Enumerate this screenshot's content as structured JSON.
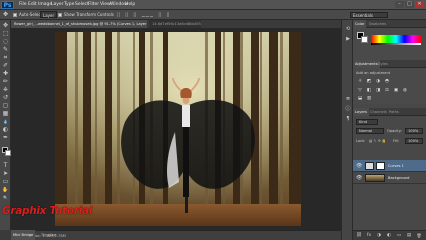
{
  "app": {
    "logo": "Ps",
    "menu": [
      "File",
      "Edit",
      "Image",
      "Layer",
      "Type",
      "Select",
      "Filter",
      "View",
      "Window",
      "Help"
    ],
    "window_controls": {
      "minimize": "–",
      "maximize": "□",
      "close": "✕"
    }
  },
  "options_bar": {
    "auto_select_label": "Auto-Select:",
    "auto_select_value": "Layer",
    "show_transform_label": "Show Transform Controls",
    "workspace": "Essentials"
  },
  "tabs": [
    {
      "label": "flower_girl_...weddbonnel_1_of_shubmoseb.jpg @ 91.7% (Curves 1, Layer Mask/8)",
      "active": true
    },
    {
      "label": "14.6d7ef56c13a6cd8bb0f3b88.jpg @ 66.7% (RGB/8)",
      "active": false
    }
  ],
  "toolbar": {
    "tools": [
      "move-icon",
      "marquee-icon",
      "lasso-icon",
      "quick-select-icon",
      "crop-icon",
      "eyedropper-icon",
      "healing-icon",
      "brush-icon",
      "stamp-icon",
      "history-brush-icon",
      "eraser-icon",
      "gradient-icon",
      "blur-icon",
      "dodge-icon",
      "pen-icon",
      "type-icon",
      "path-select-icon",
      "shape-icon",
      "hand-icon",
      "zoom-icon"
    ],
    "glyphs": [
      "✥",
      "⬚",
      "◌",
      "✎",
      "⌗",
      "✐",
      "✚",
      "✏",
      "⎈",
      "↺",
      "◻",
      "▦",
      "💧",
      "◐",
      "✒",
      "T",
      "➤",
      "▭",
      "✋",
      "🔍"
    ]
  },
  "status_bar": {
    "zoom": "91.67%",
    "doc_info": "Doc: 1.48M/2.78M",
    "minibridge_tab": "Mini Bridge",
    "timeline_tab": "Timeline"
  },
  "watermark": "Graphix Tutorial",
  "right_icons": [
    "history-icon",
    "actions-icon",
    "properties-icon",
    "info-icon",
    "paragraph-icon"
  ],
  "right_icon_glyphs": [
    "⟲",
    "▶",
    "≣",
    "ⓘ",
    "¶"
  ],
  "panels": {
    "color_tabs": [
      "Color",
      "Swatches"
    ],
    "adjust_tabs": [
      "Adjustments",
      "Styles"
    ],
    "adjust_title": "Add an adjustment",
    "adjust_icons": [
      "☼",
      "◩",
      "◑",
      "◓",
      "▽",
      "◧",
      "◨",
      "⚖",
      "▣",
      "◍",
      "⬓",
      "▥"
    ],
    "layers_tabs": [
      "Layers",
      "Channels",
      "Paths"
    ],
    "kind_label": "Kind",
    "blend_mode": "Normal",
    "opacity_label": "Opacity:",
    "opacity_value": "100%",
    "lock_label": "Lock:",
    "fill_label": "Fill:",
    "fill_value": "100%",
    "layers": [
      {
        "name": "Curves 1",
        "visible": true,
        "selected": true
      },
      {
        "name": "Background",
        "visible": true,
        "selected": false
      }
    ],
    "footer_icons": [
      "⛓",
      "fx",
      "◑",
      "◐",
      "▭",
      "▤",
      "🗑"
    ]
  },
  "colors": {
    "accent_selected_layer": "#4f6b8a",
    "watermark_red": "#d8201c",
    "ui_dark": "#484848"
  }
}
